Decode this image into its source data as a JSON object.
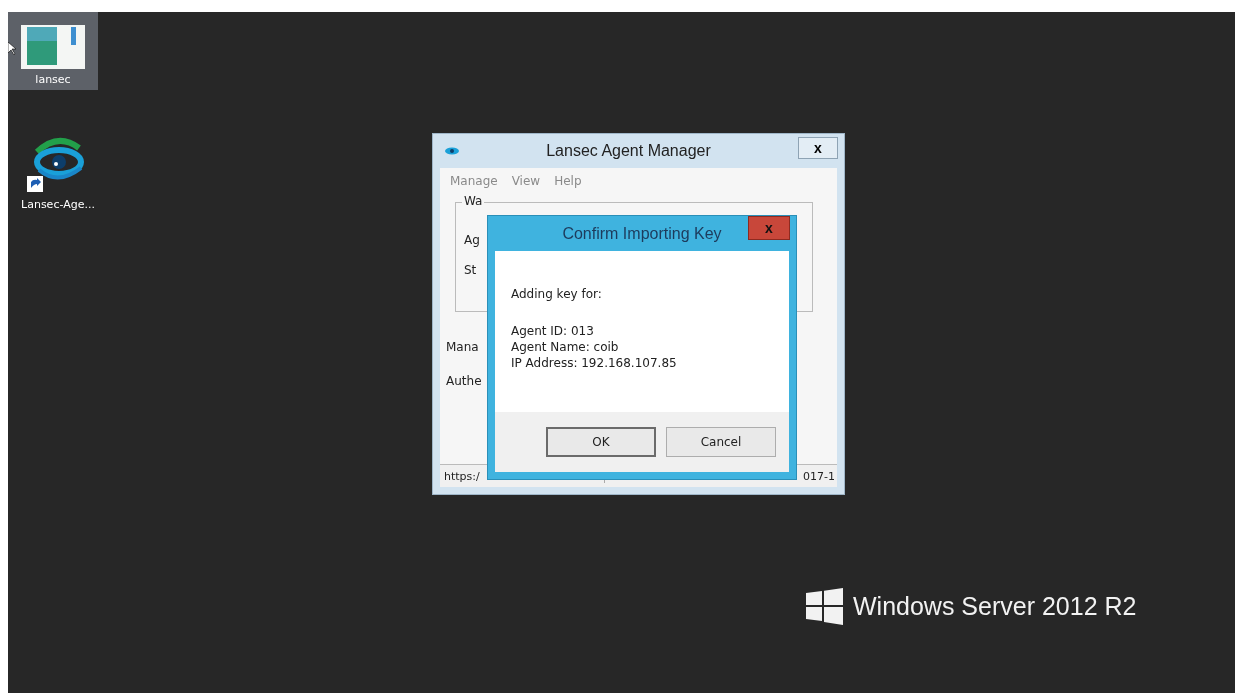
{
  "desktop": {
    "icons": [
      {
        "kind": "document",
        "label": "lansec",
        "selected": true
      },
      {
        "kind": "eye-shortcut",
        "label": "Lansec-Age...",
        "selected": false
      }
    ],
    "branding": "Windows Server 2012 R2"
  },
  "main_window": {
    "title": "Lansec Agent Manager",
    "close": "x",
    "menu": [
      "Manage",
      "View",
      "Help"
    ],
    "group_label": "Wa",
    "group_fields": [
      "Ag",
      "St"
    ],
    "fields": [
      "Mana",
      "Authe"
    ],
    "status_bar": [
      "https:/",
      "017-1"
    ]
  },
  "dialog": {
    "title": "Confirm Importing Key",
    "close": "x",
    "intro": "Adding key for:",
    "details": [
      "Agent ID: 013",
      "Agent Name: coib",
      "IP Address: 192.168.107.85"
    ],
    "buttons": [
      {
        "label": "OK",
        "default": true
      },
      {
        "label": "Cancel",
        "default": false
      }
    ]
  }
}
